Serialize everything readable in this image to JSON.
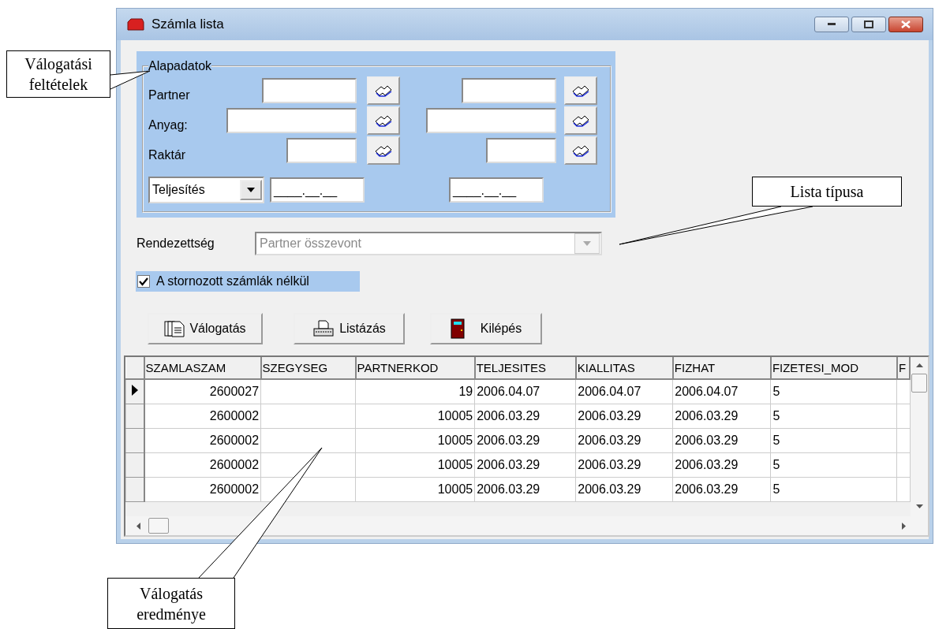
{
  "window": {
    "title": "Számla lista"
  },
  "filter_group": {
    "title": "Alapadatok",
    "rows": [
      {
        "label": "Partner"
      },
      {
        "label": "Anyag:"
      },
      {
        "label": "Raktár"
      }
    ],
    "date_type": {
      "value": "Teljesítés"
    },
    "date_from": {
      "value": "____.__.__"
    },
    "date_to": {
      "value": "____.__.__"
    }
  },
  "ordering": {
    "label": "Rendezettség",
    "value": "Partner összevont",
    "disabled": true
  },
  "storno_filter": {
    "label": "A stornozott számlák nélkül",
    "checked": true
  },
  "buttons": [
    {
      "label": "Válogatás",
      "kind": "filter"
    },
    {
      "label": "Listázás",
      "kind": "print"
    },
    {
      "label": "Kilépés",
      "kind": "exit"
    }
  ],
  "grid": {
    "columns": [
      {
        "label": "SZAMLASZAM",
        "kind": "number"
      },
      {
        "label": "SZEGYSEG",
        "kind": "text"
      },
      {
        "label": "PARTNERKOD",
        "kind": "number"
      },
      {
        "label": "TELJESITES",
        "kind": "text"
      },
      {
        "label": "KIALLITAS",
        "kind": "text"
      },
      {
        "label": "FIZHAT",
        "kind": "text"
      },
      {
        "label": "FIZETESI_MOD",
        "kind": "text"
      },
      {
        "label": "F",
        "kind": "text"
      }
    ],
    "rows": [
      {
        "selected": true,
        "cells": [
          "2600027",
          null,
          "19",
          "2006.04.07",
          "2006.04.07",
          "2006.04.07",
          "5",
          null
        ]
      },
      {
        "selected": false,
        "cells": [
          "2600002",
          null,
          "10005",
          "2006.03.29",
          "2006.03.29",
          "2006.03.29",
          "5",
          null
        ]
      },
      {
        "selected": false,
        "cells": [
          "2600002",
          null,
          "10005",
          "2006.03.29",
          "2006.03.29",
          "2006.03.29",
          "5",
          null
        ]
      },
      {
        "selected": false,
        "cells": [
          "2600002",
          null,
          "10005",
          "2006.03.29",
          "2006.03.29",
          "2006.03.29",
          "5",
          null
        ]
      },
      {
        "selected": false,
        "cells": [
          "2600002",
          null,
          "10005",
          "2006.03.29",
          "2006.03.29",
          "2006.03.29",
          "5",
          null
        ]
      }
    ]
  },
  "callouts": [
    {
      "text": "Válogatási\nfeltételek"
    },
    {
      "text": "Lista típusa"
    },
    {
      "text": "Válogatás\neredménye"
    }
  ]
}
